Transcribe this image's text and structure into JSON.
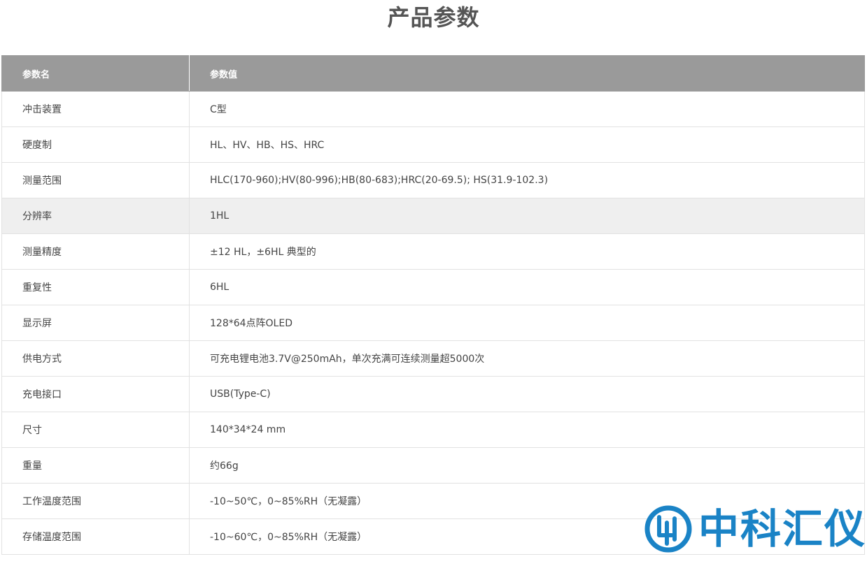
{
  "page": {
    "title": "产品参数"
  },
  "table": {
    "headers": [
      "参数名",
      "参数值"
    ],
    "rows": [
      {
        "name": "冲击装置",
        "value": "C型"
      },
      {
        "name": "硬度制",
        "value": "HL、HV、HB、HS、HRC"
      },
      {
        "name": "测量范围",
        "value": "HLC(170-960);HV(80-996);HB(80-683);HRC(20-69.5); HS(31.9-102.3)"
      },
      {
        "name": "分辨率",
        "value": "1HL"
      },
      {
        "name": "测量精度",
        "value": "±12 HL，±6HL 典型的"
      },
      {
        "name": "重复性",
        "value": "6HL"
      },
      {
        "name": "显示屏",
        "value": "128*64点阵OLED"
      },
      {
        "name": "供电方式",
        "value": "可充电锂电池3.7V@250mAh，单次充满可连续测量超5000次"
      },
      {
        "name": "充电接口",
        "value": "USB(Type-C)"
      },
      {
        "name": "尺寸",
        "value": "140*34*24 mm"
      },
      {
        "name": "重量",
        "value": "约66g"
      },
      {
        "name": "工作温度范围",
        "value": "-10~50℃，0~85%RH（无凝露）"
      },
      {
        "name": "存储温度范围",
        "value": "-10~60℃，0~85%RH（无凝露）"
      }
    ]
  },
  "watermark": {
    "text": "中科汇仪",
    "color": "#1a83c6"
  }
}
